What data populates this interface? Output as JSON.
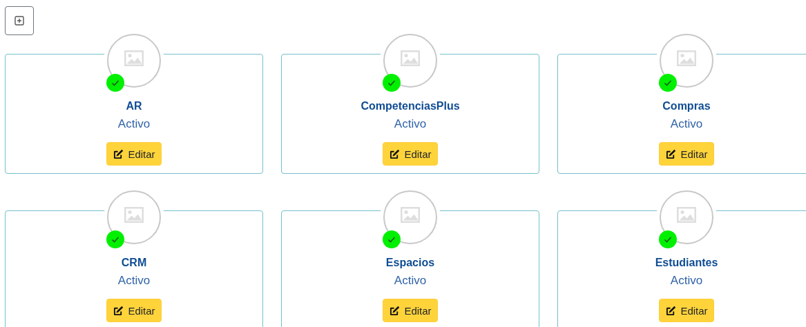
{
  "cards": [
    {
      "name": "AR",
      "status": "Activo",
      "active": true,
      "button": "Editar"
    },
    {
      "name": "CompetenciasPlus",
      "status": "Activo",
      "active": true,
      "button": "Editar"
    },
    {
      "name": "Compras",
      "status": "Activo",
      "active": true,
      "button": "Editar"
    },
    {
      "name": "CRM",
      "status": "Activo",
      "active": true,
      "button": "Editar"
    },
    {
      "name": "Espacios",
      "status": "Activo",
      "active": true,
      "button": "Editar"
    },
    {
      "name": "Estudiantes",
      "status": "Activo",
      "active": true,
      "button": "Editar"
    }
  ]
}
